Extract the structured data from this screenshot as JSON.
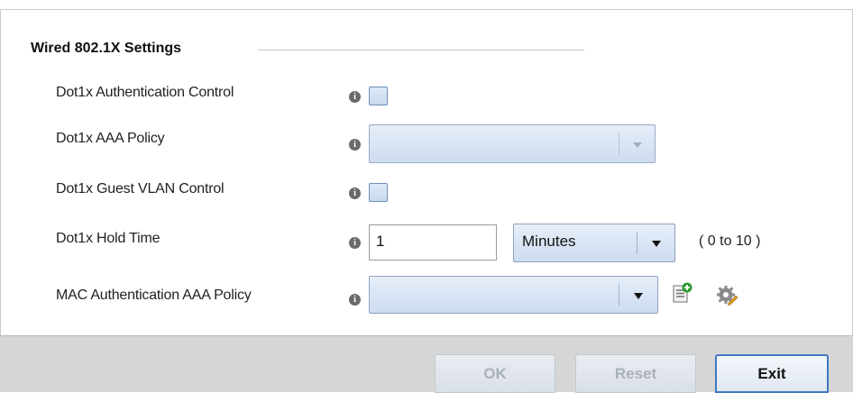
{
  "section": {
    "title": "Wired 802.1X Settings"
  },
  "fields": {
    "auth_control": {
      "label": "Dot1x Authentication Control",
      "checked": false
    },
    "aaa_policy": {
      "label": "Dot1x AAA Policy",
      "value": ""
    },
    "guest_vlan": {
      "label": "Dot1x Guest VLAN Control",
      "checked": false
    },
    "hold_time": {
      "label": "Dot1x Hold Time",
      "value": "1",
      "unit": "Minutes",
      "range": "( 0 to 10 )"
    },
    "mac_auth_policy": {
      "label": "MAC Authentication AAA Policy",
      "value": ""
    }
  },
  "icons": {
    "info": "i",
    "create": "create-policy-icon",
    "edit": "edit-policy-icon"
  },
  "buttons": {
    "ok": "OK",
    "reset": "Reset",
    "exit": "Exit"
  },
  "colors": {
    "accent": "#3f78c0",
    "field_fill": "#dfeaf7",
    "disabled_text": "#a9b0ba",
    "footer_bg": "#d6d6d6"
  }
}
